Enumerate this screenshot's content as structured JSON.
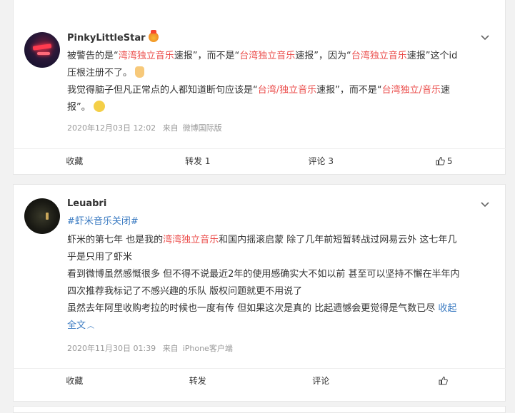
{
  "comments": [
    {
      "username": "PinkyLittleStar",
      "text_lines": [
        [
          "被警告的是“",
          "湾湾独立音乐",
          "速报”，而不是“",
          "台湾独立音乐",
          "速报”，因为“",
          "台湾独立音乐",
          "速报”这个id"
        ],
        [
          "压根注册不了。"
        ],
        [
          "我觉得脑子但凡正常点的人都知道断句应该是“",
          "台湾/独立音乐",
          "速报”，而不是“",
          "台湾独立/音乐",
          "速"
        ],
        [
          "报”。"
        ]
      ],
      "timestamp": "2020年12月03日 12:02",
      "source_prefix": "来自",
      "source": "微博国际版",
      "actions": {
        "favorite": "收藏",
        "repost": "转发 1",
        "comment": "评论 3",
        "like": "5"
      }
    },
    {
      "username": "Leuabri",
      "hashtag": "#虾米音乐关闭#",
      "text_lines": [
        [
          "虾米的第七年 也是我的",
          "湾湾独立音乐",
          "和国内摇滚启蒙 除了几年前短暂转战过网易云外 这七年几"
        ],
        [
          "乎是只用了虾米"
        ],
        [
          "看到微博虽然感慨很多 但不得不说最近2年的使用感确实大不如以前 甚至可以坚持不懈在半年内"
        ],
        [
          "四次推荐我标记了不感兴趣的乐队 版权问题就更不用说了"
        ],
        [
          "虽然去年阿里收购考拉的时候也一度有传 但如果这次是真的 比起遗憾会更觉得是气数已尽"
        ]
      ],
      "collapse_label": "收起",
      "full_text_label": "全文",
      "timestamp": "2020年11月30日 01:39",
      "source_prefix": "来自",
      "source": "iPhone客户端",
      "actions": {
        "favorite": "收藏",
        "repost": "转发",
        "comment": "评论",
        "like": ""
      }
    }
  ],
  "colors": {
    "highlight": "#eb4d4b",
    "link": "#3b7bc2"
  }
}
